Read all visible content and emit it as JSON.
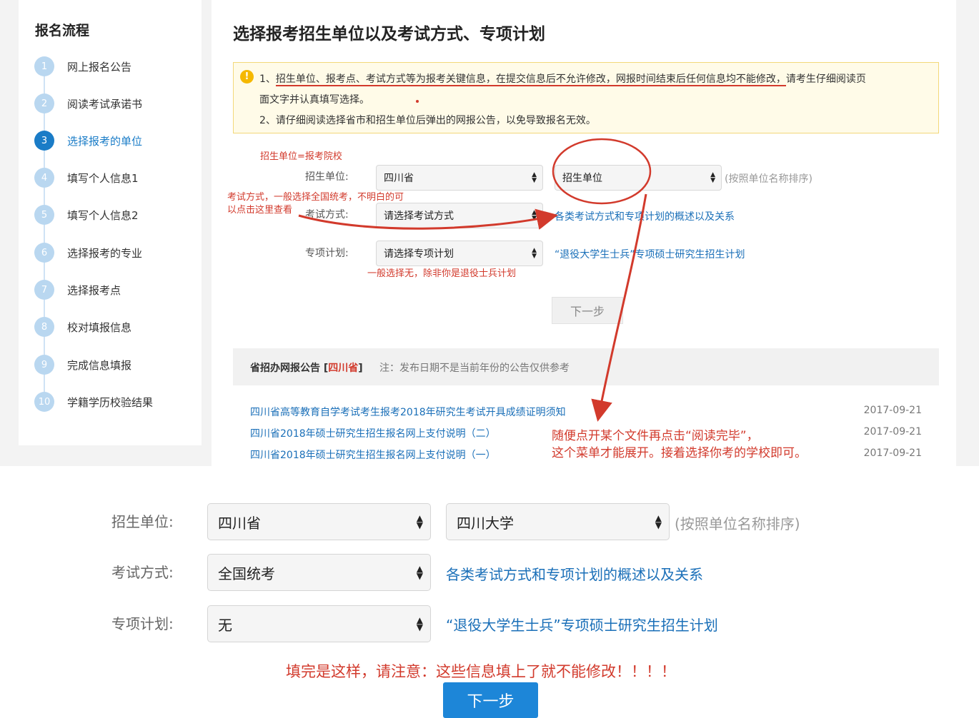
{
  "sidebar": {
    "title": "报名流程",
    "steps": [
      {
        "num": "1",
        "label": "网上报名公告"
      },
      {
        "num": "2",
        "label": "阅读考试承诺书"
      },
      {
        "num": "3",
        "label": "选择报考的单位"
      },
      {
        "num": "4",
        "label": "填写个人信息1"
      },
      {
        "num": "5",
        "label": "填写个人信息2"
      },
      {
        "num": "6",
        "label": "选择报考的专业"
      },
      {
        "num": "7",
        "label": "选择报考点"
      },
      {
        "num": "8",
        "label": "校对填报信息"
      },
      {
        "num": "9",
        "label": "完成信息填报"
      },
      {
        "num": "10",
        "label": "学籍学历校验结果"
      }
    ],
    "active_step": "3"
  },
  "main": {
    "title": "选择报考招生单位以及考试方式、专项计划",
    "notice": {
      "line1_prefix": "1、",
      "line1_underlined": "招生单位、报考点、考试方式等为报考关键信息，在提交信息后不允许修改，网报时间结束后任何信息均不能修改，",
      "line1_suffix": "请考生仔细阅读页",
      "line1_cont": "面文字并认真填写选择。",
      "line2": "2、请仔细阅读选择省市和招生单位后弹出的网报公告，以免导致报名无效。"
    },
    "form": {
      "unit_label": "招生单位:",
      "province_value": "四川省",
      "unit_value": "招生单位",
      "unit_hint": "(按照单位名称排序)",
      "exam_label": "考试方式:",
      "exam_value": "请选择考试方式",
      "exam_link": "各类考试方式和专项计划的概述以及关系",
      "plan_label": "专项计划:",
      "plan_value": "请选择专项计划",
      "plan_link": "“退役大学生士兵”专项硕士研究生招生计划",
      "next_button": "下一步"
    },
    "annotations": {
      "unit_note": "招生单位=报考院校",
      "exam_note_1": "考试方式，一般选择全国统考，不明白的可",
      "exam_note_2": "以点击这里查看",
      "plan_note": "一般选择无，除非你是退役士兵计划",
      "file_note_1": "随便点开某个文件再点击“阅读完毕”，",
      "file_note_2": "这个菜单才能展开。接着选择你考的学校即可。"
    },
    "announcements": {
      "head_title_prefix": "省招办网报公告 [",
      "head_province": "四川省",
      "head_title_suffix": "]",
      "head_note": "注：发布日期不是当前年份的公告仅供参考",
      "items": [
        {
          "title": "四川省高等教育自学考试考生报考2018年研究生考试开具成绩证明须知",
          "date": "2017-09-21"
        },
        {
          "title": "四川省2018年硕士研究生招生报名网上支付说明（二）",
          "date": "2017-09-21"
        },
        {
          "title": "四川省2018年硕士研究生招生报名网上支付说明（一）",
          "date": "2017-09-21"
        }
      ]
    }
  },
  "bottom": {
    "unit_label": "招生单位:",
    "province_value": "四川省",
    "unit_value": "四川大学",
    "unit_hint": "(按照单位名称排序)",
    "exam_label": "考试方式:",
    "exam_value": "全国统考",
    "exam_link": "各类考试方式和专项计划的概述以及关系",
    "plan_label": "专项计划:",
    "plan_value": "无",
    "plan_link": "“退役大学生士兵”专项硕士研究生招生计划",
    "warning": "填完是这样，请注意：这些信息填上了就不能修改！！！！",
    "next_button": "下一步"
  },
  "colors": {
    "accent": "#1a7cc7",
    "link": "#1a6fb8",
    "annotation_red": "#d23a2c",
    "primary_button": "#1d86d8",
    "notice_bg": "#fffbe8"
  }
}
